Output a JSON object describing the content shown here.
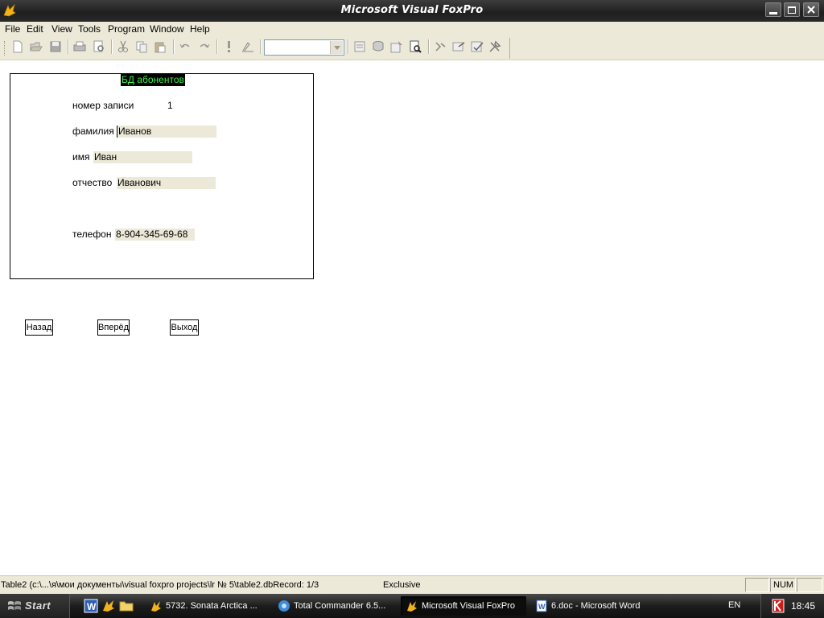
{
  "window": {
    "title": "Microsoft Visual FoxPro"
  },
  "menu": [
    "File",
    "Edit",
    "View",
    "Tools",
    "Program",
    "Window",
    "Help"
  ],
  "toolbar": {
    "icons": [
      "new-icon",
      "open-icon",
      "save-icon",
      "print-icon",
      "print-preview-icon",
      "cut-icon",
      "copy-icon",
      "paste-icon",
      "undo-icon",
      "redo-icon",
      "run-icon",
      "modify-icon",
      "database-combo",
      "command-window-icon",
      "data-session-icon",
      "properties-icon",
      "form-designer-icon",
      "code-icon",
      "form-control-icon",
      "form-builder-icon",
      "toolbox-icon"
    ],
    "combo_value": ""
  },
  "form": {
    "header": "БД абонентов",
    "record_label": "номер записи",
    "record_value": "1",
    "surname_label": "фамилия",
    "surname_value": "Иванов",
    "name_label": "имя",
    "name_value": "Иван",
    "patronymic_label": "отчество",
    "patronymic_value": "Иванович",
    "phone_label": "телефон",
    "phone_value": "8-904-345-69-68"
  },
  "buttons": {
    "back": "Назад",
    "forward": "Вперёд",
    "exit": "Выход"
  },
  "status": {
    "path": "Table2 (c:\\...\\я\\мои документы\\visual foxpro projects\\lr № 5\\table2.dbRecord: 1/3",
    "mode": "Exclusive",
    "num": "NUM"
  },
  "taskbar": {
    "start": "Start",
    "tasks": [
      {
        "label": "5732. Sonata Arctica ..."
      },
      {
        "label": "Total Commander 6.5..."
      },
      {
        "label": "Microsoft Visual FoxPro"
      },
      {
        "label": "6.doc - Microsoft Word"
      }
    ],
    "lang": "EN",
    "clock": "18:45"
  },
  "colors": {
    "header_bg": "#000000",
    "header_text": "#3cf04a",
    "field_bg": "#ece9d8",
    "chrome": "#ece9d8"
  }
}
